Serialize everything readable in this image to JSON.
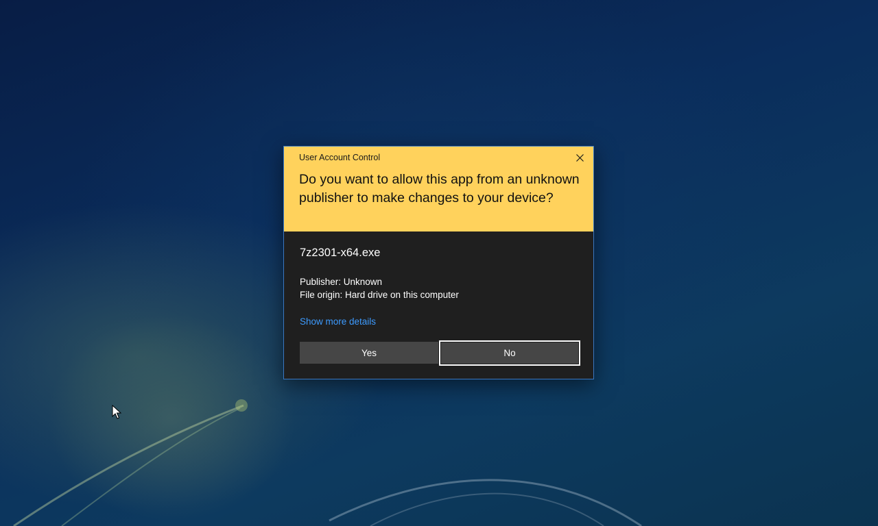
{
  "uac": {
    "caption": "User Account Control",
    "question": "Do you want to allow this app from an unknown publisher to make changes to your device?",
    "app_name": "7z2301-x64.exe",
    "publisher": "Publisher: Unknown",
    "file_origin": "File origin: Hard drive on this computer",
    "details_link": "Show more details",
    "yes_label": "Yes",
    "no_label": "No",
    "focused_button": "No"
  },
  "icons": {
    "close": "close-icon",
    "cursor": "mouse-pointer-icon"
  },
  "colors": {
    "header_bg": "#ffd25c",
    "body_bg": "#1f1f1f",
    "link": "#3d9bff",
    "button_bg": "#464646",
    "dialog_border": "#3a78c2"
  }
}
